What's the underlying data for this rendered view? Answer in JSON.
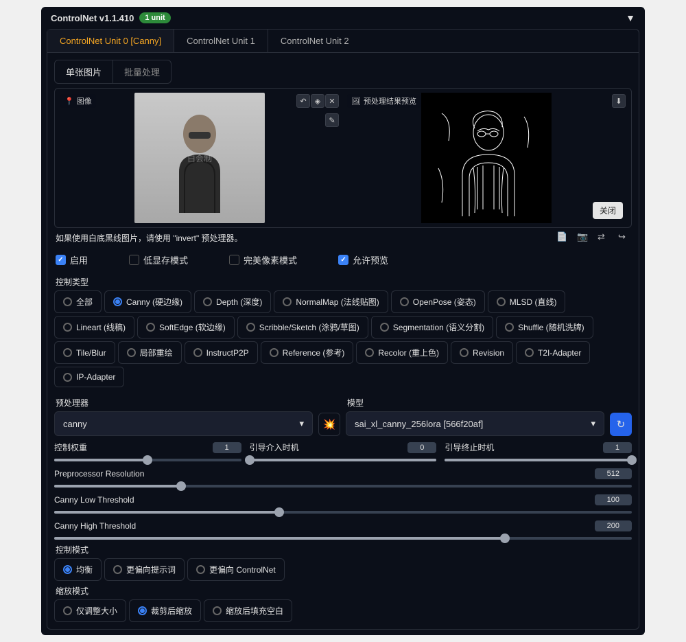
{
  "header": {
    "title": "ControlNet v1.1.410",
    "badge": "1 unit"
  },
  "tabs": [
    "ControlNet Unit 0 [Canny]",
    "ControlNet Unit 1",
    "ControlNet Unit 2"
  ],
  "subtabs": [
    "单张图片",
    "批量处理"
  ],
  "img": {
    "label_left": "图像",
    "label_right": "预处理结果预览",
    "watermark": "白会制",
    "close": "关闭"
  },
  "hint": "如果使用白底黑线图片，请使用 \"invert\" 预处理器。",
  "checks": {
    "enable": "启用",
    "lowvram": "低显存模式",
    "pixel": "完美像素模式",
    "preview": "允许预览"
  },
  "section": {
    "control_type": "控制类型",
    "preproc": "预处理器",
    "model": "模型",
    "control_mode": "控制模式",
    "resize_mode": "缩放模式"
  },
  "types": [
    "全部",
    "Canny (硬边缘)",
    "Depth (深度)",
    "NormalMap (法线贴图)",
    "OpenPose (姿态)",
    "MLSD (直线)",
    "Lineart (线稿)",
    "SoftEdge (软边缘)",
    "Scribble/Sketch (涂鸦/草图)",
    "Segmentation (语义分割)",
    "Shuffle (随机洗牌)",
    "Tile/Blur",
    "局部重绘",
    "InstructP2P",
    "Reference (参考)",
    "Recolor (重上色)",
    "Revision",
    "T2I-Adapter",
    "IP-Adapter"
  ],
  "preproc_value": "canny",
  "model_value": "sai_xl_canny_256lora [566f20af]",
  "sliders": {
    "weight": {
      "label": "控制权重",
      "value": "1",
      "pct": 50
    },
    "start": {
      "label": "引导介入时机",
      "value": "0",
      "pct": 0,
      "fill": 100
    },
    "end": {
      "label": "引导终止时机",
      "value": "1",
      "pct": 100
    },
    "res": {
      "label": "Preprocessor Resolution",
      "value": "512",
      "pct": 22
    },
    "low": {
      "label": "Canny Low Threshold",
      "value": "100",
      "pct": 39
    },
    "high": {
      "label": "Canny High Threshold",
      "value": "200",
      "pct": 78
    }
  },
  "modes": [
    "均衡",
    "更偏向提示词",
    "更偏向 ControlNet"
  ],
  "resize": [
    "仅调整大小",
    "裁剪后缩放",
    "缩放后填充空白"
  ]
}
